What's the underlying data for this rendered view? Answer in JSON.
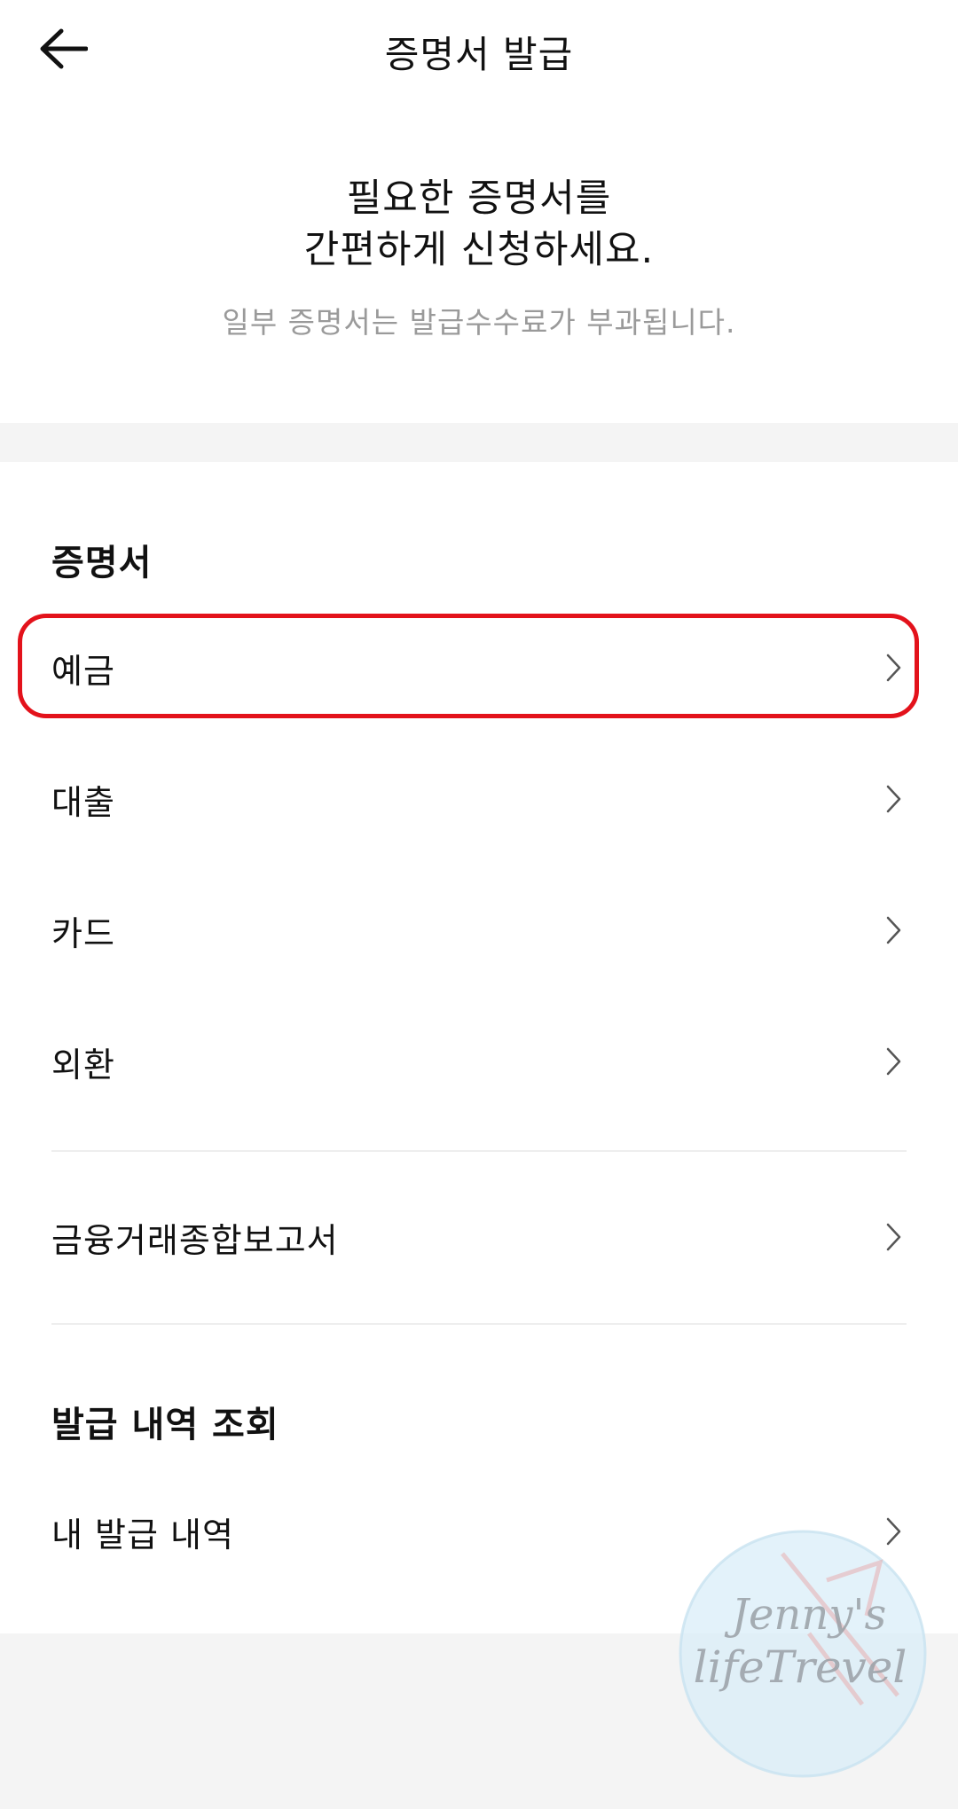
{
  "header": {
    "title": "증명서 발급",
    "back_icon": "arrow-left-icon"
  },
  "intro": {
    "headline_line1": "필요한 증명서를",
    "headline_line2": "간편하게 신청하세요.",
    "note": "일부 증명서는 발급수수료가 부과됩니다."
  },
  "certificates": {
    "section_title": "증명서",
    "items": [
      {
        "label": "예금"
      },
      {
        "label": "대출"
      },
      {
        "label": "카드"
      },
      {
        "label": "외환"
      },
      {
        "label": "금융거래종합보고서"
      }
    ]
  },
  "history": {
    "section_title": "발급 내역 조회",
    "items": [
      {
        "label": "내 발급 내역"
      }
    ]
  },
  "watermark": {
    "line1": "Jenny's",
    "line2": "lifeTrevel"
  },
  "colors": {
    "highlight": "#e3121b",
    "section_band": "#f4f4f4",
    "muted_text": "#9a9a9a"
  }
}
